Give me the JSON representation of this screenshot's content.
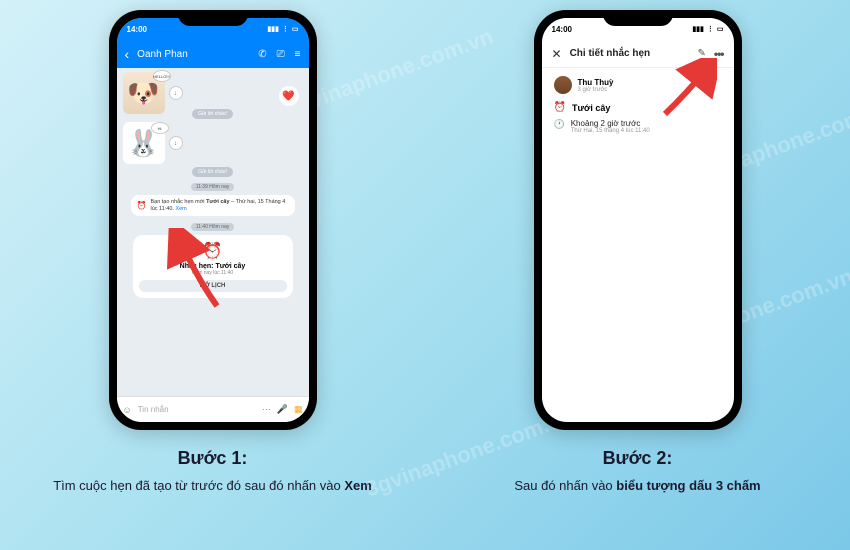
{
  "watermark": "3gvinaphone.com.vn",
  "phone1": {
    "time": "14:00",
    "contact": "Oanh Phan",
    "sticker1_bubble": "HELLO!!!",
    "sticker2_bubble": "Hi",
    "pill_resend": "Gửi lời chào!",
    "time_divider1": "11:39 Hôm nay",
    "notif_prefix": "Bạn tạo nhắc hẹn mới",
    "notif_event": "Tưới cây",
    "notif_time": "Thứ hai, 15 Tháng 4 lúc 11:40.",
    "notif_xem": "Xem",
    "time_divider2": "11:40 Hôm nay",
    "reminder_title": "Nhắc hẹn: Tưới cây",
    "reminder_sub": "Hôm nay lúc 11:40",
    "open_calendar": "MỞ LỊCH",
    "input_placeholder": "Tin nhắn"
  },
  "phone2": {
    "time": "14:00",
    "title": "Chi tiết nhắc hẹn",
    "user_name": "Thu Thuỳ",
    "user_sub": "3 giờ trước",
    "event_name": "Tưới cây",
    "time_main": "Khoảng 2 giờ trước",
    "time_sub": "Thứ Hai, 15 tháng 4 lúc 11:40"
  },
  "step1": {
    "title": "Bước 1:",
    "desc_pre": "Tìm cuộc hẹn đã tạo từ trước đó sau đó nhấn vào ",
    "desc_bold": "Xem"
  },
  "step2": {
    "title": "Bước 2:",
    "desc_pre": "Sau đó nhấn vào ",
    "desc_bold": "biểu tượng dấu 3 chấm"
  }
}
